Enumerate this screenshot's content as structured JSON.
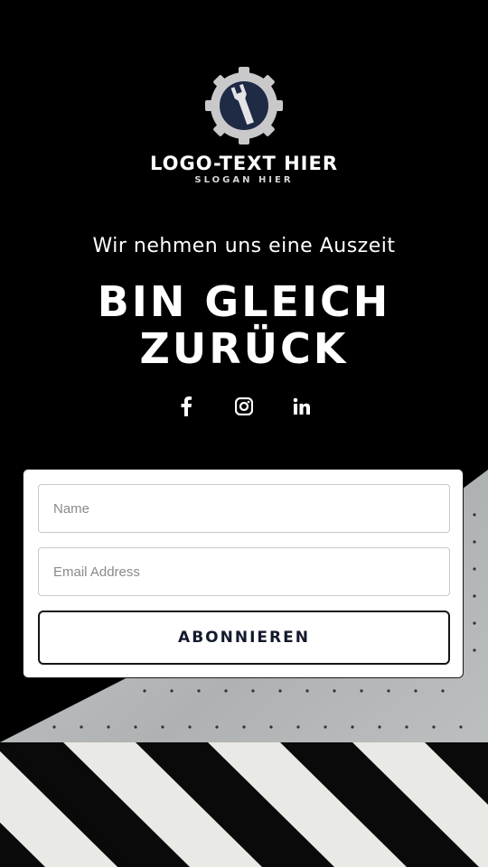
{
  "logo": {
    "icon": "wrench-gear-icon",
    "text": "LOGO-TEXT HIER",
    "slogan": "SLOGAN HIER"
  },
  "tagline": "Wir nehmen uns eine Auszeit",
  "headline": {
    "line1": "BIN GLEICH",
    "line2": "ZURÜCK"
  },
  "social": [
    {
      "icon": "facebook-icon"
    },
    {
      "icon": "instagram-icon"
    },
    {
      "icon": "linkedin-icon"
    }
  ],
  "form": {
    "name_placeholder": "Name",
    "email_placeholder": "Email Address",
    "submit_label": "ABONNIEREN"
  },
  "colors": {
    "background": "#000000",
    "concrete": "#b9bcbc",
    "stripe": "#e9e9e6",
    "button_text": "#141a2e"
  }
}
